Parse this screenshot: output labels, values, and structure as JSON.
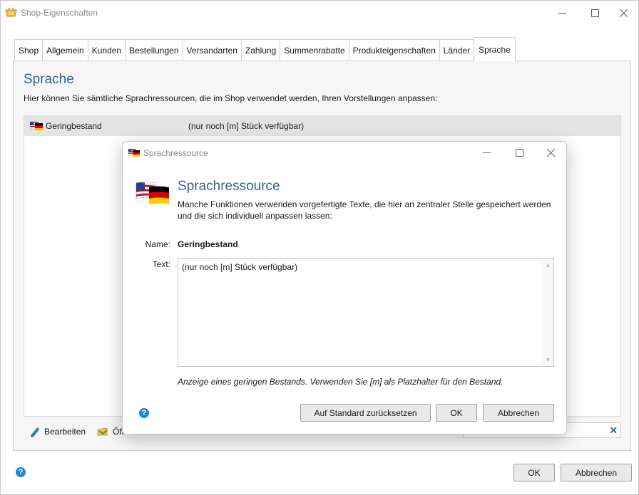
{
  "window": {
    "title": "Shop-Eigenschaften"
  },
  "tabs": [
    {
      "label": "Shop"
    },
    {
      "label": "Allgemein"
    },
    {
      "label": "Kunden"
    },
    {
      "label": "Bestellungen"
    },
    {
      "label": "Versandarten"
    },
    {
      "label": "Zahlung"
    },
    {
      "label": "Summenrabatte"
    },
    {
      "label": "Produkteigenschaften"
    },
    {
      "label": "Länder"
    },
    {
      "label": "Sprache"
    }
  ],
  "active_tab": "Sprache",
  "page": {
    "heading": "Sprache",
    "description": "Hier können Sie sämtliche Sprachressourcen, die im Shop verwendet werden, Ihren Vorstellungen anpassen:"
  },
  "list": {
    "rows": [
      {
        "name": "Geringbestand",
        "value": "(nur noch [m] Stück verfügbar)",
        "icon": "flag-us-de-icon"
      }
    ]
  },
  "toolbar": {
    "edit_label": "Bearbeiten",
    "open_label": "Öff"
  },
  "footer": {
    "ok_label": "OK",
    "cancel_label": "Abbrechen"
  },
  "dialog": {
    "title": "Sprachressource",
    "heading": "Sprachressource",
    "description": "Manche Funktionen verwenden vorgefertigte Texte, die hier an zentraler Stelle gespeichert werden und die sich individuell anpassen lassen:",
    "name_label": "Name:",
    "name_value": "Geringbestand",
    "text_label": "Text:",
    "text_value": "(nur noch [m] Stück verfügbar)",
    "hint": "Anzeige eines geringen Bestands. Verwenden Sie [m] als Platzhalter für den Bestand.",
    "reset_label": "Auf Standard zurücksetzen",
    "ok_label": "OK",
    "cancel_label": "Abbrechen"
  },
  "colors": {
    "accent_heading": "#3a6391",
    "help_blue": "#1e88d6"
  }
}
